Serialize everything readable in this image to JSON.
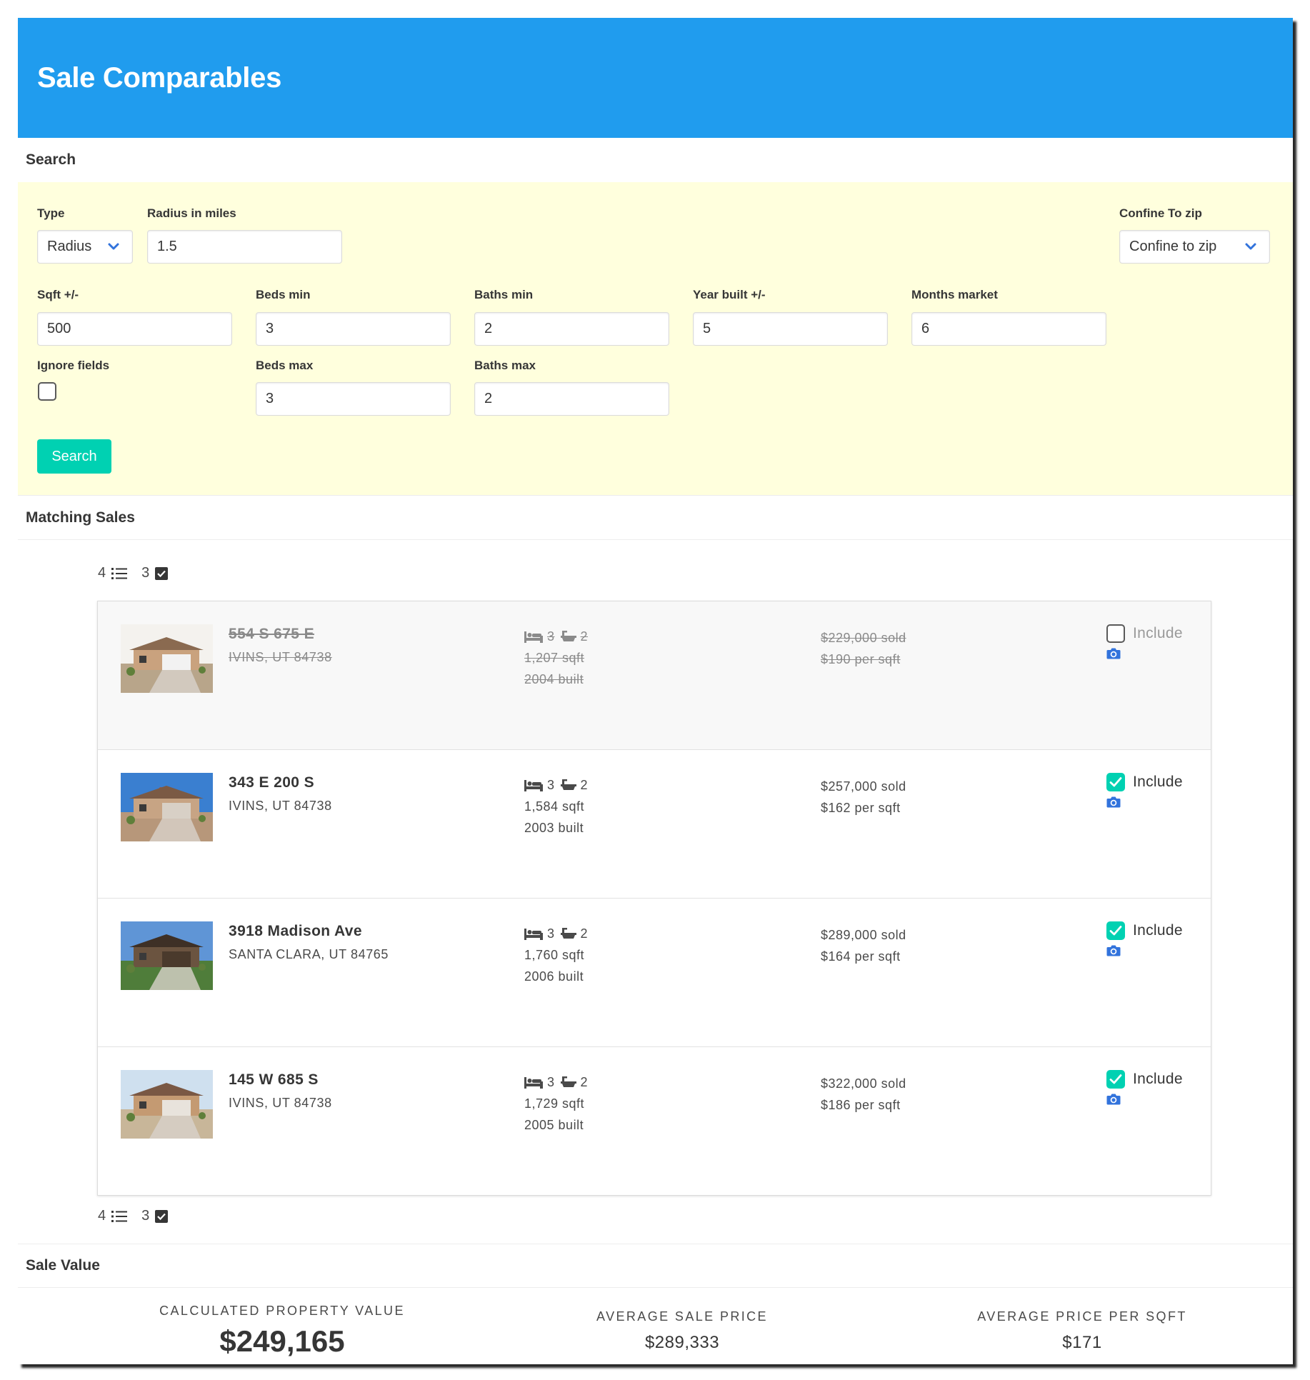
{
  "header": {
    "title": "Sale Comparables"
  },
  "search": {
    "heading": "Search",
    "type": {
      "label": "Type",
      "value": "Radius"
    },
    "radius": {
      "label": "Radius in miles",
      "value": "1.5"
    },
    "confine": {
      "label": "Confine To zip",
      "value": "Confine to zip"
    },
    "sqft": {
      "label": "Sqft +/-",
      "value": "500"
    },
    "beds_min": {
      "label": "Beds min",
      "value": "3"
    },
    "baths_min": {
      "label": "Baths min",
      "value": "2"
    },
    "year_built": {
      "label": "Year built +/-",
      "value": "5"
    },
    "months_market": {
      "label": "Months market",
      "value": "6"
    },
    "ignore_fields": {
      "label": "Ignore fields",
      "checked": false
    },
    "beds_max": {
      "label": "Beds max",
      "value": "3"
    },
    "baths_max": {
      "label": "Baths max",
      "value": "2"
    },
    "button": "Search"
  },
  "matching": {
    "heading": "Matching Sales",
    "total_count": "4",
    "included_count": "3",
    "listings": [
      {
        "street": "554 S 675 E",
        "city": "IVINS, UT 84738",
        "beds": "3",
        "baths": "2",
        "sqft": "1,207 sqft",
        "built": "2004 built",
        "sold": "$229,000 sold",
        "per_sqft": "$190 per sqft",
        "include_label": "Include",
        "included": false
      },
      {
        "street": "343 E 200 S",
        "city": "IVINS, UT 84738",
        "beds": "3",
        "baths": "2",
        "sqft": "1,584 sqft",
        "built": "2003 built",
        "sold": "$257,000 sold",
        "per_sqft": "$162 per sqft",
        "include_label": "Include",
        "included": true
      },
      {
        "street": "3918 Madison Ave",
        "city": "SANTA CLARA, UT 84765",
        "beds": "3",
        "baths": "2",
        "sqft": "1,760 sqft",
        "built": "2006 built",
        "sold": "$289,000 sold",
        "per_sqft": "$164 per sqft",
        "include_label": "Include",
        "included": true
      },
      {
        "street": "145 W 685 S",
        "city": "IVINS, UT 84738",
        "beds": "3",
        "baths": "2",
        "sqft": "1,729 sqft",
        "built": "2005 built",
        "sold": "$322,000 sold",
        "per_sqft": "$186 per sqft",
        "include_label": "Include",
        "included": true
      }
    ]
  },
  "sale_value": {
    "heading": "Sale Value",
    "calculated": {
      "caption": "CALCULATED PROPERTY VALUE",
      "value": "$249,165"
    },
    "average_price": {
      "caption": "AVERAGE SALE PRICE",
      "value": "$289,333"
    },
    "average_per_sqft": {
      "caption": "AVERAGE PRICE PER SQFT",
      "value": "$171"
    }
  },
  "colors": {
    "hero": "#209cee",
    "search_bg": "#ffffdd",
    "primary": "#00d1b2",
    "camera": "#3273dc"
  }
}
